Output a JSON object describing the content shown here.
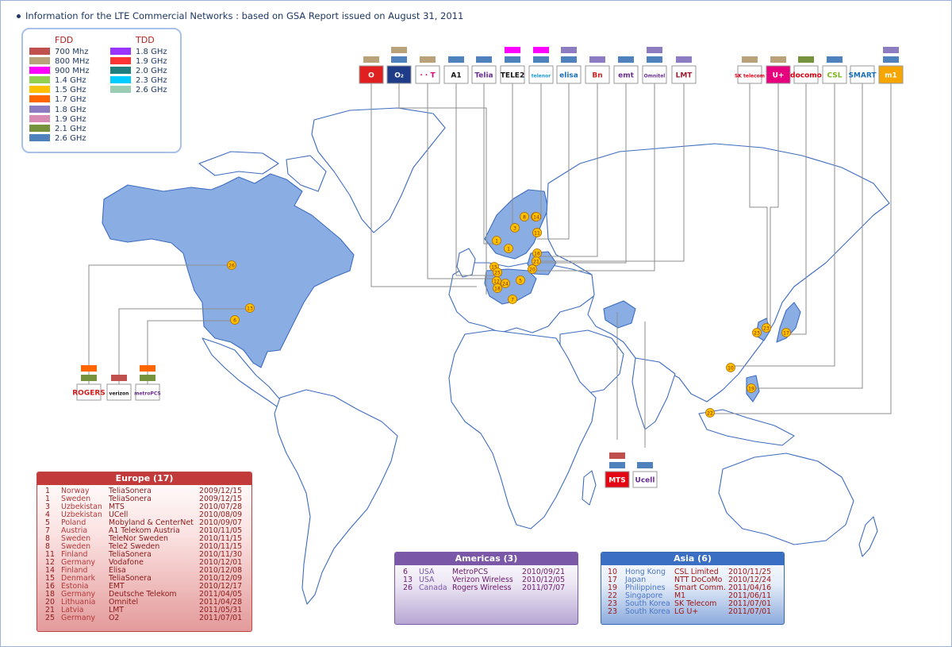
{
  "title": "Information for the LTE Commercial Networks : based on GSA Report issued on August 31, 2011",
  "legend": {
    "fdd_label": "FDD",
    "tdd_label": "TDD",
    "fdd": [
      {
        "label": "700 Mhz",
        "color": "#c0504d"
      },
      {
        "label": "800 MHz",
        "color": "#b9a27a"
      },
      {
        "label": "900 MHz",
        "color": "#ff00ff"
      },
      {
        "label": "1.4 GHz",
        "color": "#92d050"
      },
      {
        "label": "1.5 GHz",
        "color": "#ffc000"
      },
      {
        "label": "1.7 GHz",
        "color": "#ff6600"
      },
      {
        "label": "1.8 GHz",
        "color": "#8e7cc3"
      },
      {
        "label": "1.9 GHz",
        "color": "#d88bb3"
      },
      {
        "label": "2.1 GHz",
        "color": "#76923c"
      },
      {
        "label": "2.6 GHz",
        "color": "#4f81bd"
      }
    ],
    "tdd": [
      {
        "label": "1.8 GHz",
        "color": "#9933ff"
      },
      {
        "label": "1.9 GHz",
        "color": "#ff3333"
      },
      {
        "label": "2.0 GHz",
        "color": "#1f7f7f"
      },
      {
        "label": "2.3 GHz",
        "color": "#00ccff"
      },
      {
        "label": "2.6 GHz",
        "color": "#99ccb3"
      }
    ]
  },
  "logos": {
    "top": [
      {
        "text": "O",
        "color": "#e02020",
        "fg": "#ffffff",
        "bands": [
          "#b9a27a"
        ]
      },
      {
        "text": "O₂",
        "color": "#1f3c88",
        "fg": "#ffffff",
        "bands": [
          "#b9a27a",
          "#4f81bd"
        ]
      },
      {
        "text": "· · T",
        "color": "#ffffff",
        "fg": "#e20074",
        "bands": [
          "#b9a27a"
        ]
      },
      {
        "text": "A1",
        "color": "#ffffff",
        "fg": "#111111",
        "bands": [
          "#4f81bd"
        ]
      },
      {
        "text": "Telia",
        "color": "#ffffff",
        "fg": "#6a2c91",
        "bands": [
          "#4f81bd"
        ]
      },
      {
        "text": "TELE2",
        "color": "#ffffff",
        "fg": "#111111",
        "bands": [
          "#ff00ff",
          "#4f81bd"
        ]
      },
      {
        "text": "telenor",
        "color": "#ffffff",
        "fg": "#1a9ad6",
        "bands": [
          "#ff00ff",
          "#4f81bd"
        ]
      },
      {
        "text": "elisa",
        "color": "#ffffff",
        "fg": "#1a6fb5",
        "bands": [
          "#8e7cc3",
          "#4f81bd"
        ]
      },
      {
        "text": "Bn",
        "color": "#ffffff",
        "fg": "#d21f1f",
        "bands": [
          "#8e7cc3"
        ]
      },
      {
        "text": "emt",
        "color": "#ffffff",
        "fg": "#6a2c91",
        "bands": [
          "#4f81bd"
        ]
      },
      {
        "text": "Omnitel",
        "color": "#ffffff",
        "fg": "#6a2c91",
        "bands": [
          "#8e7cc3",
          "#4f81bd"
        ]
      },
      {
        "text": "LMT",
        "color": "#ffffff",
        "fg": "#9b1b30",
        "bands": [
          "#8e7cc3"
        ]
      },
      {
        "text": "SK telecom",
        "color": "#ffffff",
        "fg": "#e2001a",
        "bands": [
          "#b9a27a"
        ]
      },
      {
        "text": "U+",
        "color": "#e6007e",
        "fg": "#ffffff",
        "bands": [
          "#b9a27a"
        ]
      },
      {
        "text": "docomo",
        "color": "#ffffff",
        "fg": "#d7000f",
        "bands": [
          "#76923c"
        ]
      },
      {
        "text": "CSL",
        "color": "#ffffff",
        "fg": "#7ab317",
        "bands": [
          "#4f81bd"
        ]
      },
      {
        "text": "SMART",
        "color": "#ffffff",
        "fg": "#1a6fb5",
        "bands": []
      },
      {
        "text": "m1",
        "color": "#f7a600",
        "fg": "#ffffff",
        "bands": [
          "#8e7cc3",
          "#4f81bd"
        ]
      }
    ],
    "americas": [
      {
        "text": "ROGERS",
        "color": "#ffffff",
        "fg": "#d21f1f",
        "bands": [
          "#ff6600",
          "#76923c"
        ]
      },
      {
        "text": "verizon",
        "color": "#ffffff",
        "fg": "#111111",
        "bands": [
          "#c0504d"
        ]
      },
      {
        "text": "metroPCS",
        "color": "#ffffff",
        "fg": "#6a2c91",
        "bands": [
          "#ff6600",
          "#76923c"
        ]
      }
    ],
    "central_asia": [
      {
        "text": "MTS",
        "color": "#e30613",
        "fg": "#ffffff",
        "bands": [
          "#c0504d",
          "#4f81bd"
        ]
      },
      {
        "text": "Ucell",
        "color": "#ffffff",
        "fg": "#6a2c91",
        "bands": [
          "#4f81bd"
        ]
      }
    ]
  },
  "markers": [
    {
      "n": "1"
    },
    {
      "n": "1"
    },
    {
      "n": "3"
    },
    {
      "n": "4"
    },
    {
      "n": "5"
    },
    {
      "n": "7"
    },
    {
      "n": "8"
    },
    {
      "n": "8"
    },
    {
      "n": "11"
    },
    {
      "n": "12"
    },
    {
      "n": "14"
    },
    {
      "n": "15"
    },
    {
      "n": "16"
    },
    {
      "n": "18"
    },
    {
      "n": "20"
    },
    {
      "n": "21"
    },
    {
      "n": "24"
    },
    {
      "n": "25"
    },
    {
      "n": "26"
    },
    {
      "n": "13"
    },
    {
      "n": "6"
    },
    {
      "n": "10"
    },
    {
      "n": "17"
    },
    {
      "n": "19"
    },
    {
      "n": "22"
    },
    {
      "n": "23"
    },
    {
      "n": "23"
    }
  ],
  "tables": {
    "europe": {
      "header": "Europe (17)",
      "rows": [
        {
          "no": "1",
          "country": "Norway",
          "operator": "TeliaSonera",
          "date": "2009/12/15"
        },
        {
          "no": "1",
          "country": "Sweden",
          "operator": "TeliaSonera",
          "date": "2009/12/15"
        },
        {
          "no": "3",
          "country": "Uzbekistan",
          "operator": "MTS",
          "date": "2010/07/28"
        },
        {
          "no": "4",
          "country": "Uzbekistan",
          "operator": "UCell",
          "date": "2010/08/09"
        },
        {
          "no": "5",
          "country": "Poland",
          "operator": "Mobyland & CenterNet",
          "date": "2010/09/07"
        },
        {
          "no": "7",
          "country": "Austria",
          "operator": "A1 Telekom Austria",
          "date": "2010/11/05"
        },
        {
          "no": "8",
          "country": "Sweden",
          "operator": "TeleNor Sweden",
          "date": "2010/11/15"
        },
        {
          "no": "8",
          "country": "Sweden",
          "operator": "Tele2 Sweden",
          "date": "2010/11/15"
        },
        {
          "no": "11",
          "country": "Finland",
          "operator": "TeliaSonera",
          "date": "2010/11/30"
        },
        {
          "no": "12",
          "country": "Germany",
          "operator": "Vodafone",
          "date": "2010/12/01"
        },
        {
          "no": "14",
          "country": "Finland",
          "operator": "Elisa",
          "date": "2010/12/08"
        },
        {
          "no": "15",
          "country": "Denmark",
          "operator": "TeliaSonera",
          "date": "2010/12/09"
        },
        {
          "no": "16",
          "country": "Estonia",
          "operator": "EMT",
          "date": "2010/12/17"
        },
        {
          "no": "18",
          "country": "Germany",
          "operator": "Deutsche Telekom",
          "date": "2011/04/05"
        },
        {
          "no": "20",
          "country": "Lithuania",
          "operator": "Omnitel",
          "date": "2011/04/28"
        },
        {
          "no": "21",
          "country": "Latvia",
          "operator": "LMT",
          "date": "2011/05/31"
        },
        {
          "no": "25",
          "country": "Germany",
          "operator": "O2",
          "date": "2011/07/01"
        }
      ]
    },
    "americas": {
      "header": "Americas (3)",
      "rows": [
        {
          "no": "6",
          "country": "USA",
          "operator": "MetroPCS",
          "date": "2010/09/21"
        },
        {
          "no": "13",
          "country": "USA",
          "operator": "Verizon Wireless",
          "date": "2010/12/05"
        },
        {
          "no": "26",
          "country": "Canada",
          "operator": "Rogers Wireless",
          "date": "2011/07/07"
        }
      ]
    },
    "asia": {
      "header": "Asia (6)",
      "rows": [
        {
          "no": "10",
          "country": "Hong Kong",
          "operator": "CSL Limited",
          "date": "2010/11/25"
        },
        {
          "no": "17",
          "country": "Japan",
          "operator": "NTT DoCoMo",
          "date": "2010/12/24"
        },
        {
          "no": "19",
          "country": "Philippines",
          "operator": "Smart Comm.",
          "date": "2011/04/16"
        },
        {
          "no": "22",
          "country": "Singapore",
          "operator": "M1",
          "date": "2011/06/11"
        },
        {
          "no": "23",
          "country": "South Korea",
          "operator": "SK Telecom",
          "date": "2011/07/01"
        },
        {
          "no": "23",
          "country": "South Korea",
          "operator": "LG U+",
          "date": "2011/07/01"
        }
      ]
    }
  }
}
